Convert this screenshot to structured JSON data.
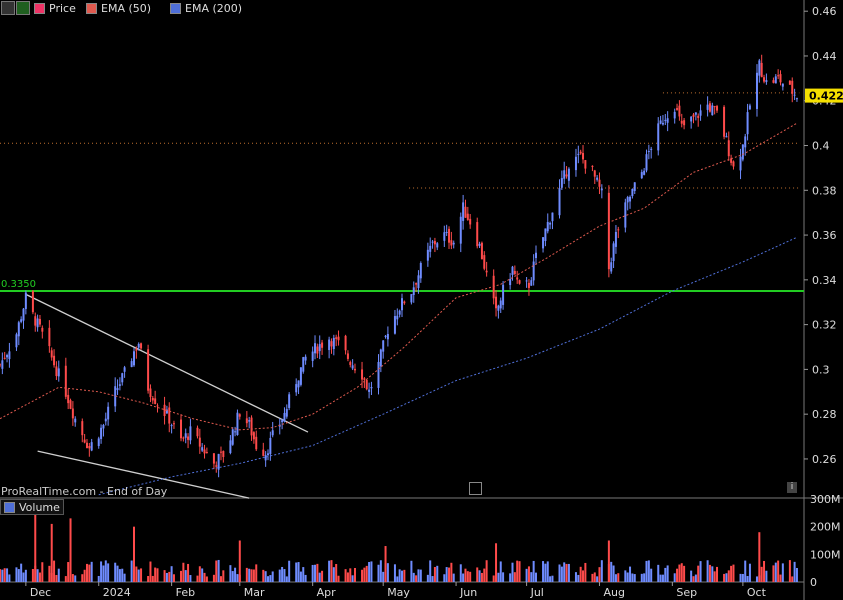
{
  "legend": {
    "price": "Price",
    "ema50": "EMA (50)",
    "ema200": "EMA (200)",
    "volume": "Volume"
  },
  "watermark": "ProRealTime.com - End of Day",
  "colors": {
    "up": "#6f8cff",
    "down": "#ff4b4b",
    "ema50": "#e05a4f",
    "ema200": "#4f6fd8",
    "support": "#22cc22",
    "price_tag": "#f5e000",
    "grid_dot": "#c07030"
  },
  "chart_data": [
    {
      "type": "candlestick",
      "ylim": [
        0.243,
        0.465
      ],
      "y_ticks": [
        0.46,
        0.44,
        0.42,
        0.4,
        0.38,
        0.36,
        0.34,
        0.32,
        0.3,
        0.28,
        0.26
      ],
      "x_ticks": [
        {
          "label": "Dec",
          "date": "2023-12-01"
        },
        {
          "label": "2024",
          "date": "2024-01-01"
        },
        {
          "label": "Feb",
          "date": "2024-02-01"
        },
        {
          "label": "Mar",
          "date": "2024-03-01"
        },
        {
          "label": "Apr",
          "date": "2024-04-01"
        },
        {
          "label": "May",
          "date": "2024-05-01"
        },
        {
          "label": "Jun",
          "date": "2024-06-01"
        },
        {
          "label": "Jul",
          "date": "2024-07-01"
        },
        {
          "label": "Aug",
          "date": "2024-08-01"
        },
        {
          "label": "Sep",
          "date": "2024-09-01"
        },
        {
          "label": "Oct",
          "date": "2024-10-01"
        }
      ],
      "last_price": "0.4223",
      "support_level": {
        "label": "0.3350",
        "value": 0.335
      },
      "dotted_levels": [
        {
          "value": 0.401,
          "from": "2023-11-20",
          "to": "2024-10-25"
        },
        {
          "value": 0.381,
          "from": "2024-05-12",
          "to": "2024-10-25"
        },
        {
          "value": 0.4235,
          "from": "2024-08-28",
          "to": "2024-10-25"
        }
      ],
      "trendlines": [
        {
          "from": [
            "2023-12-01",
            0.3335
          ],
          "to": [
            "2024-03-30",
            0.272
          ]
        },
        {
          "from": [
            "2023-12-06",
            0.2635
          ],
          "to": [
            "2024-03-05",
            0.2425
          ]
        }
      ],
      "close_path": [
        [
          "2023-11-20",
          0.302
        ],
        [
          "2023-11-27",
          0.316
        ],
        [
          "2023-12-01",
          0.332
        ],
        [
          "2023-12-04",
          0.324
        ],
        [
          "2023-12-07",
          0.318
        ],
        [
          "2023-12-12",
          0.305
        ],
        [
          "2023-12-18",
          0.29
        ],
        [
          "2023-12-22",
          0.278
        ],
        [
          "2023-12-28",
          0.265
        ],
        [
          "2024-01-03",
          0.275
        ],
        [
          "2024-01-08",
          0.29
        ],
        [
          "2024-01-12",
          0.298
        ],
        [
          "2024-01-16",
          0.308
        ],
        [
          "2024-01-18",
          0.312
        ],
        [
          "2024-01-22",
          0.292
        ],
        [
          "2024-01-26",
          0.285
        ],
        [
          "2024-01-31",
          0.278
        ],
        [
          "2024-02-05",
          0.268
        ],
        [
          "2024-02-09",
          0.272
        ],
        [
          "2024-02-14",
          0.265
        ],
        [
          "2024-02-19",
          0.258
        ],
        [
          "2024-02-23",
          0.262
        ],
        [
          "2024-02-27",
          0.272
        ],
        [
          "2024-03-01",
          0.281
        ],
        [
          "2024-03-05",
          0.275
        ],
        [
          "2024-03-08",
          0.266
        ],
        [
          "2024-03-12",
          0.263
        ],
        [
          "2024-03-15",
          0.27
        ],
        [
          "2024-03-20",
          0.28
        ],
        [
          "2024-03-25",
          0.295
        ],
        [
          "2024-03-29",
          0.305
        ],
        [
          "2024-04-03",
          0.31
        ],
        [
          "2024-04-08",
          0.314
        ],
        [
          "2024-04-12",
          0.311
        ],
        [
          "2024-04-17",
          0.304
        ],
        [
          "2024-04-22",
          0.298
        ],
        [
          "2024-04-25",
          0.29
        ],
        [
          "2024-04-29",
          0.302
        ],
        [
          "2024-05-03",
          0.318
        ],
        [
          "2024-05-08",
          0.328
        ],
        [
          "2024-05-13",
          0.335
        ],
        [
          "2024-05-17",
          0.345
        ],
        [
          "2024-05-22",
          0.356
        ],
        [
          "2024-05-27",
          0.36
        ],
        [
          "2024-05-31",
          0.357
        ],
        [
          "2024-06-04",
          0.372
        ],
        [
          "2024-06-07",
          0.366
        ],
        [
          "2024-06-11",
          0.355
        ],
        [
          "2024-06-14",
          0.342
        ],
        [
          "2024-06-18",
          0.325
        ],
        [
          "2024-06-21",
          0.335
        ],
        [
          "2024-06-25",
          0.345
        ],
        [
          "2024-06-28",
          0.336
        ],
        [
          "2024-07-02",
          0.338
        ],
        [
          "2024-07-05",
          0.35
        ],
        [
          "2024-07-10",
          0.365
        ],
        [
          "2024-07-15",
          0.38
        ],
        [
          "2024-07-19",
          0.392
        ],
        [
          "2024-07-24",
          0.395
        ],
        [
          "2024-07-29",
          0.388
        ],
        [
          "2024-08-02",
          0.378
        ],
        [
          "2024-08-05",
          0.345
        ],
        [
          "2024-08-08",
          0.36
        ],
        [
          "2024-08-13",
          0.375
        ],
        [
          "2024-08-19",
          0.388
        ],
        [
          "2024-08-23",
          0.4
        ],
        [
          "2024-08-28",
          0.412
        ],
        [
          "2024-09-02",
          0.418
        ],
        [
          "2024-09-05",
          0.408
        ],
        [
          "2024-09-10",
          0.412
        ],
        [
          "2024-09-16",
          0.418
        ],
        [
          "2024-09-20",
          0.414
        ],
        [
          "2024-09-24",
          0.402
        ],
        [
          "2024-09-27",
          0.39
        ],
        [
          "2024-10-01",
          0.4
        ],
        [
          "2024-10-04",
          0.418
        ],
        [
          "2024-10-08",
          0.436
        ],
        [
          "2024-10-11",
          0.428
        ],
        [
          "2024-10-16",
          0.43
        ],
        [
          "2024-10-21",
          0.425
        ],
        [
          "2024-10-24",
          0.4223
        ]
      ],
      "ema50_path": [
        [
          "2023-11-20",
          0.278
        ],
        [
          "2023-12-15",
          0.292
        ],
        [
          "2024-01-01",
          0.29
        ],
        [
          "2024-01-20",
          0.285
        ],
        [
          "2024-02-10",
          0.278
        ],
        [
          "2024-03-01",
          0.273
        ],
        [
          "2024-03-15",
          0.274
        ],
        [
          "2024-04-01",
          0.28
        ],
        [
          "2024-04-20",
          0.292
        ],
        [
          "2024-05-10",
          0.31
        ],
        [
          "2024-06-01",
          0.332
        ],
        [
          "2024-06-20",
          0.338
        ],
        [
          "2024-07-10",
          0.35
        ],
        [
          "2024-08-01",
          0.364
        ],
        [
          "2024-08-20",
          0.372
        ],
        [
          "2024-09-10",
          0.388
        ],
        [
          "2024-10-01",
          0.396
        ],
        [
          "2024-10-24",
          0.41
        ]
      ],
      "ema200_path": [
        [
          "2024-01-01",
          0.244
        ],
        [
          "2024-02-01",
          0.252
        ],
        [
          "2024-03-01",
          0.258
        ],
        [
          "2024-04-01",
          0.266
        ],
        [
          "2024-05-01",
          0.28
        ],
        [
          "2024-06-01",
          0.295
        ],
        [
          "2024-07-01",
          0.305
        ],
        [
          "2024-08-01",
          0.318
        ],
        [
          "2024-09-01",
          0.335
        ],
        [
          "2024-10-01",
          0.348
        ],
        [
          "2024-10-24",
          0.359
        ]
      ]
    },
    {
      "type": "bar",
      "name": "Volume",
      "ylim": [
        0,
        300000000
      ],
      "y_ticks": [
        {
          "label": "300M",
          "value": 300000000
        },
        {
          "label": "200M",
          "value": 200000000
        },
        {
          "label": "100M",
          "value": 100000000
        },
        {
          "label": "0",
          "value": 0
        }
      ],
      "spikes": [
        [
          "2023-12-05",
          260000000
        ],
        [
          "2023-12-12",
          210000000
        ],
        [
          "2023-12-20",
          230000000
        ],
        [
          "2024-01-16",
          200000000
        ],
        [
          "2024-03-01",
          150000000
        ],
        [
          "2024-05-02",
          130000000
        ],
        [
          "2024-06-18",
          140000000
        ],
        [
          "2024-08-05",
          150000000
        ],
        [
          "2024-10-08",
          180000000
        ]
      ]
    }
  ]
}
